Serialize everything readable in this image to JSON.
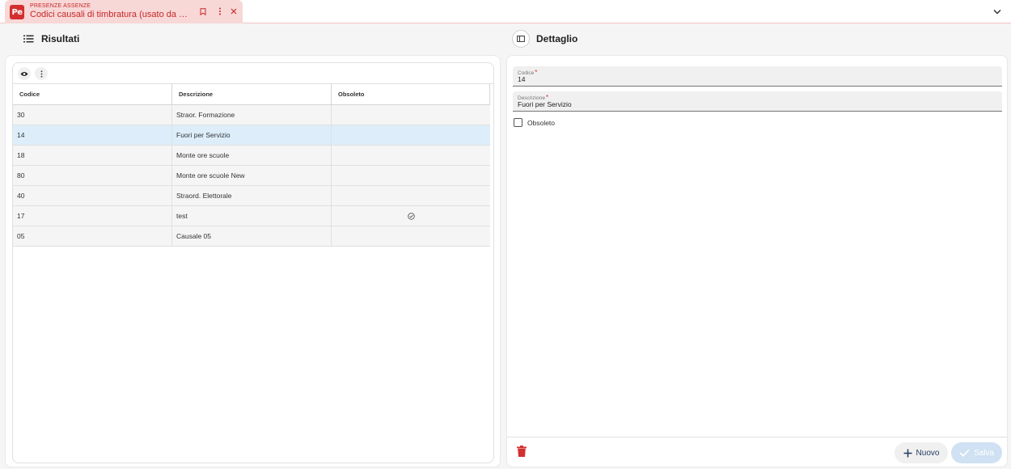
{
  "tab": {
    "app_name": "PRESENZE ASSENZE",
    "title": "Codici causali di timbratura (usato da en...",
    "logo_text": "Pe",
    "icons": [
      "bookmark-icon",
      "more-vert-icon",
      "close-icon"
    ]
  },
  "results": {
    "title": "Risultati",
    "icon": "list-icon",
    "toolbar_icons": [
      "eye-icon",
      "more-vert-icon"
    ],
    "columns": [
      "Codice",
      "Descrizione",
      "Obsoleto"
    ],
    "rows": [
      {
        "codice": "30",
        "descrizione": "Straor. Formazione",
        "obsoleto": false
      },
      {
        "codice": "14",
        "descrizione": "Fuori per Servizio",
        "obsoleto": false,
        "selected": true
      },
      {
        "codice": "18",
        "descrizione": "Monte ore scuole",
        "obsoleto": false
      },
      {
        "codice": "80",
        "descrizione": "Monte ore scuole New",
        "obsoleto": false
      },
      {
        "codice": "40",
        "descrizione": "Straord. Elettorale",
        "obsoleto": false
      },
      {
        "codice": "17",
        "descrizione": "test",
        "obsoleto": true
      },
      {
        "codice": "05",
        "descrizione": "Causale 05",
        "obsoleto": false
      }
    ]
  },
  "detail": {
    "title": "Dettaglio",
    "icon": "panel-icon",
    "fields": {
      "codice": {
        "label": "Codice",
        "value": "14",
        "required_mark": "*"
      },
      "descrizione": {
        "label": "Descrizione",
        "value": "Fuori per Servizio",
        "required_mark": "*"
      }
    },
    "obsoleto": {
      "label": "Obsoleto",
      "checked": false
    },
    "buttons": {
      "new": "Nuovo",
      "save": "Salva"
    }
  },
  "colors": {
    "accent_red": "#d32f2f",
    "tab_bg": "#f8d7d7",
    "selected_row": "#ddeefa",
    "button_text": "#1e3a5f"
  }
}
